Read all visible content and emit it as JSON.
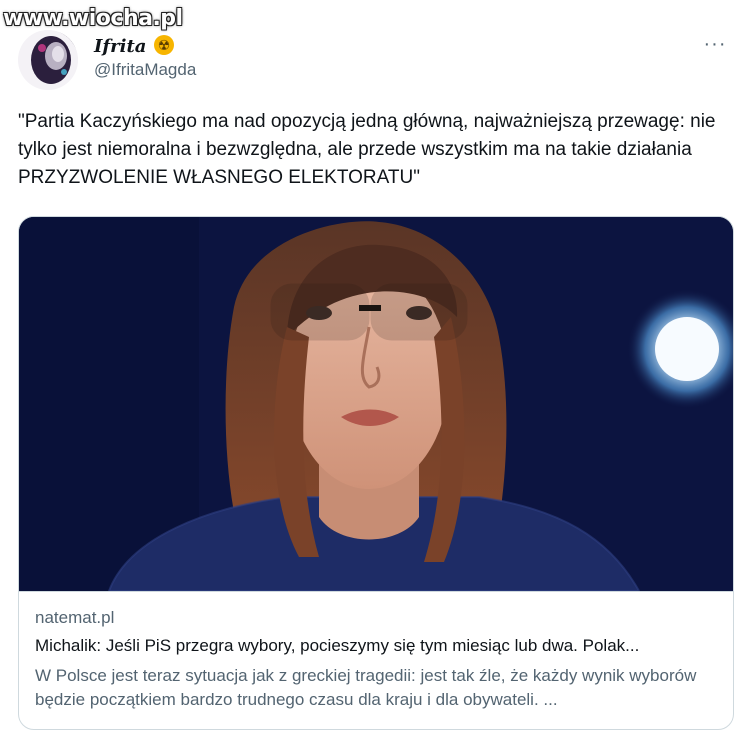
{
  "watermark": "www.wiocha.pl",
  "author": {
    "display_name": "Ifrita",
    "badge_icon": "radioactive-badge-icon",
    "badge_glyph": "☢",
    "handle": "@IfritaMagda"
  },
  "more_menu_glyph": "···",
  "tweet": {
    "text": "\"Partia Kaczyńskiego ma nad opozycją jedną główną, najważniejszą przewagę: nie tylko jest niemoralna i bezwzględna, ale przede wszystkim ma na takie działania PRZYZWOLENIE WŁASNEGO ELEKTORATU\""
  },
  "link_card": {
    "domain": "natemat.pl",
    "title": "Michalik: Jeśli PiS przegra wybory, pocieszymy się tym miesiąc lub dwa. Polak...",
    "description": "W Polsce jest teraz sytuacja jak z greckiej tragedii: jest tak źle, że każdy wynik wyborów będzie początkiem bardzo trudnego czasu dla kraju i dla obywateli. ..."
  },
  "colors": {
    "text_primary": "#0f1419",
    "text_secondary": "#536471",
    "border": "#cfd9de",
    "image_background": "#0c1440"
  }
}
